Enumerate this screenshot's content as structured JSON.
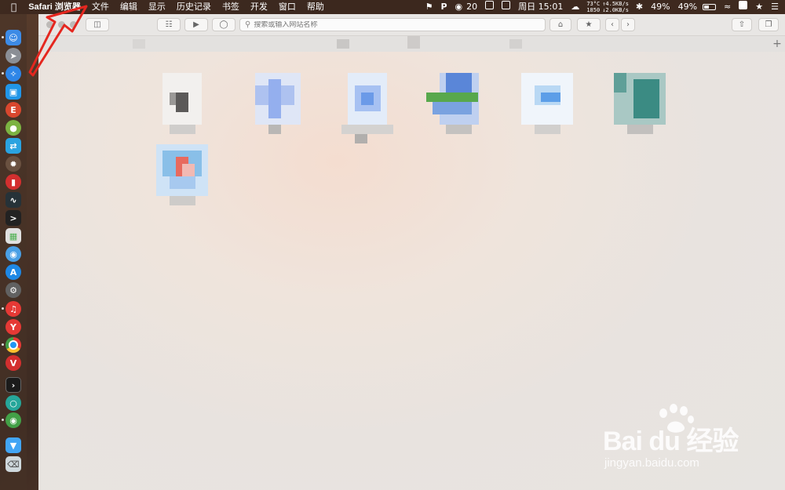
{
  "menubar": {
    "app_name": "Safari 浏览器",
    "items": [
      "文件",
      "编辑",
      "显示",
      "历史记录",
      "书签",
      "开发",
      "窗口",
      "帮助"
    ],
    "status": {
      "wechat_count": "20",
      "clock": "周日 15:01",
      "temp": "73°C",
      "rpm": "1850",
      "upload": "↑4.5KB/s",
      "download": "↓2.0KB/s",
      "battery1": "49%",
      "battery2": "49%",
      "battery_level": 0.49
    }
  },
  "toolbar": {
    "search_placeholder": "搜索或输入网站名称"
  },
  "watermark": {
    "brand": "Bai du 经验",
    "url": "jingyan.baidu.com"
  }
}
